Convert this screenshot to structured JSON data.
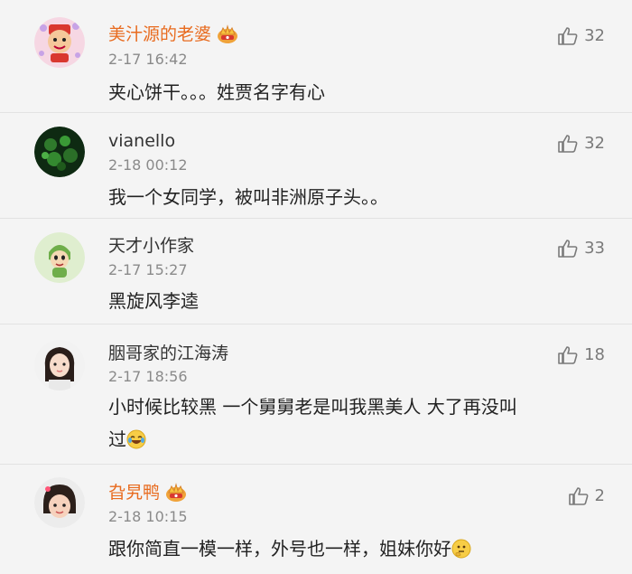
{
  "comments": [
    {
      "username": "美汁源的老婆",
      "vip": true,
      "orange": true,
      "time": "2-17 16:42",
      "text": "夹心饼干。。。姓贾名字有心",
      "text_cont": "",
      "emoji": "",
      "likes": "32"
    },
    {
      "username": "vianello",
      "vip": false,
      "orange": false,
      "time": "2-18 00:12",
      "text": "我一个女同学，被叫非洲原子头。。",
      "text_cont": "",
      "emoji": "",
      "likes": "32"
    },
    {
      "username": "天才小作家",
      "vip": false,
      "orange": false,
      "time": "2-17 15:27",
      "text": "黑旋风李逵",
      "text_cont": "",
      "emoji": "",
      "likes": "33"
    },
    {
      "username": "胭哥家的江海涛",
      "vip": false,
      "orange": false,
      "time": "2-17 18:56",
      "text": "小时候比较黑 一个舅舅老是叫我黑美人 大了再没叫",
      "text_cont": "过",
      "emoji": "laughing-tears-emoji",
      "likes": "18"
    },
    {
      "username": "旮旯鸭",
      "vip": true,
      "orange": true,
      "time": "2-18 10:15",
      "text": "跟你简直一模一样，外号也一样，姐妹你好",
      "text_cont": "",
      "emoji": "thinking-emoji",
      "likes": "2"
    }
  ],
  "colors": {
    "vip_name": "#e86b1f",
    "meta": "#8a8a8a",
    "background": "#f4f4f4"
  }
}
